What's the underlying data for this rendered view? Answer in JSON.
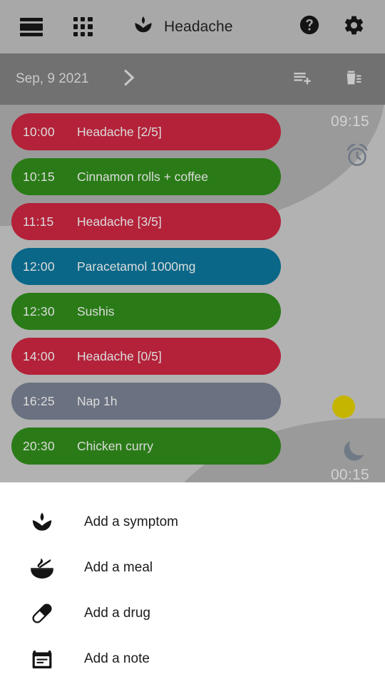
{
  "appbar": {
    "agenda_icon": "agenda-list-icon",
    "grid_icon": "grid-view-icon",
    "logo_icon": "lotus-logo-icon",
    "title": "Headache",
    "help_icon": "help-circle-icon",
    "settings_icon": "gear-icon"
  },
  "datebar": {
    "date": "Sep, 9 2021",
    "next_icon": "chevron-right-icon",
    "add_icon": "playlist-add-icon",
    "delete_icon": "delete-sweep-icon"
  },
  "day": {
    "wake_time": "09:15",
    "wake_icon": "alarm-clock-icon",
    "sleep_time": "00:15",
    "sleep_icon": "moon-icon",
    "sun_marker": "sun-dot",
    "events": [
      {
        "time": "10:00",
        "title": "Headache [2/5]",
        "color": "#b32239",
        "kind": "symptom"
      },
      {
        "time": "10:15",
        "title": "Cinnamon rolls + coffee",
        "color": "#2a7b17",
        "kind": "meal"
      },
      {
        "time": "11:15",
        "title": "Headache [3/5]",
        "color": "#b32239",
        "kind": "symptom"
      },
      {
        "time": "12:00",
        "title": "Paracetamol 1000mg",
        "color": "#0a6788",
        "kind": "drug"
      },
      {
        "time": "12:30",
        "title": "Sushis",
        "color": "#2a7b17",
        "kind": "meal"
      },
      {
        "time": "14:00",
        "title": "Headache [0/5]",
        "color": "#b32239",
        "kind": "symptom"
      },
      {
        "time": "16:25",
        "title": "Nap 1h",
        "color": "#6a7180",
        "kind": "nap"
      },
      {
        "time": "20:30",
        "title": "Chicken curry",
        "color": "#2a7b17",
        "kind": "meal"
      }
    ]
  },
  "sheet": {
    "items": [
      {
        "label": "Add a symptom",
        "icon": "lotus-icon"
      },
      {
        "label": "Add a meal",
        "icon": "noodle-bowl-icon"
      },
      {
        "label": "Add a drug",
        "icon": "pill-capsule-icon"
      },
      {
        "label": "Add a note",
        "icon": "note-icon"
      }
    ]
  },
  "colors": {
    "appbar_bg": "#a8a8a8",
    "datebar_bg": "#717171",
    "canvas_bg": "#b2b2b2",
    "sleep_arc": "#9a9a9a",
    "symptom": "#b32239",
    "meal": "#2a7b17",
    "drug": "#0a6788",
    "nap": "#6a7180",
    "sun": "#c6b500"
  }
}
